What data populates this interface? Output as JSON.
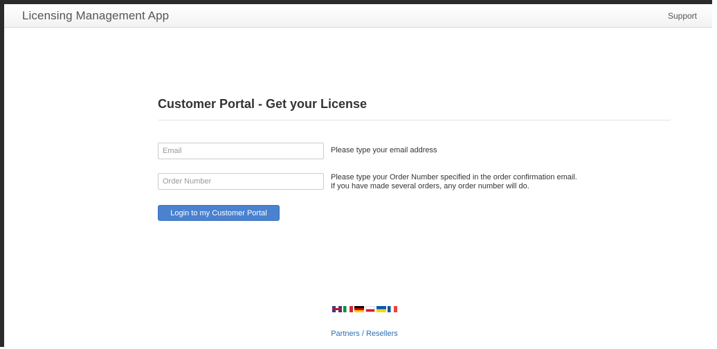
{
  "navbar": {
    "brand": "Licensing Management App",
    "support_link": "Support"
  },
  "portal": {
    "title": "Customer Portal - Get your License",
    "email": {
      "placeholder": "Email",
      "value": "",
      "help": "Please type your email address"
    },
    "order_number": {
      "placeholder": "Order Number",
      "value": "",
      "help_line1": "Please type your Order Number specified in the order confirmation email.",
      "help_line2": "If you have made several orders, any order number will do."
    },
    "login_button": "Login to my Customer Portal"
  },
  "footer": {
    "languages": [
      "uk-flag-icon",
      "italy-flag-icon",
      "germany-flag-icon",
      "poland-flag-icon",
      "ukraine-flag-icon",
      "france-flag-icon"
    ],
    "partners_link": "Partners / Resellers"
  },
  "colors": {
    "button": "#4a82d0",
    "link": "#2a6db5"
  }
}
